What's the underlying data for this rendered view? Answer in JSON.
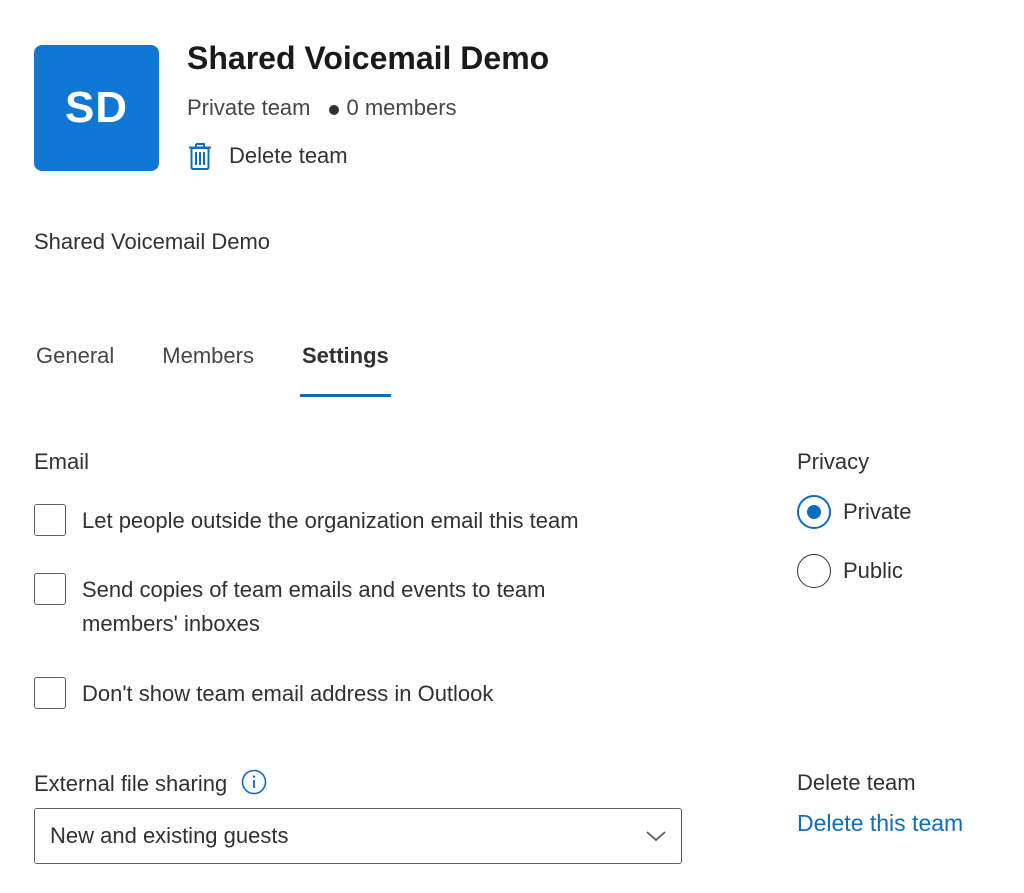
{
  "header": {
    "avatar_initials": "SD",
    "title": "Shared Voicemail Demo",
    "visibility": "Private team",
    "members_count": "0 members",
    "delete_label": "Delete team"
  },
  "description": "Shared Voicemail Demo",
  "tabs": [
    {
      "label": "General",
      "active": false
    },
    {
      "label": "Members",
      "active": false
    },
    {
      "label": "Settings",
      "active": true
    }
  ],
  "email": {
    "heading": "Email",
    "options": [
      {
        "label": "Let people outside the organization email this team",
        "checked": false
      },
      {
        "label": "Send copies of team emails and events to team members' inboxes",
        "checked": false
      },
      {
        "label": "Don't show team email address in Outlook",
        "checked": false
      }
    ]
  },
  "privacy": {
    "heading": "Privacy",
    "options": [
      {
        "label": "Private",
        "selected": true
      },
      {
        "label": "Public",
        "selected": false
      }
    ]
  },
  "external_sharing": {
    "heading": "External file sharing",
    "selected": "New and existing guests"
  },
  "delete_section": {
    "heading": "Delete team",
    "link_label": "Delete this team"
  },
  "colors": {
    "accent": "#0f6cbd",
    "avatar_bg": "#0f78d4",
    "text": "#323130"
  },
  "icons": {
    "trash": "trash-icon",
    "info": "info-icon",
    "chevron": "chevron-down-icon"
  }
}
